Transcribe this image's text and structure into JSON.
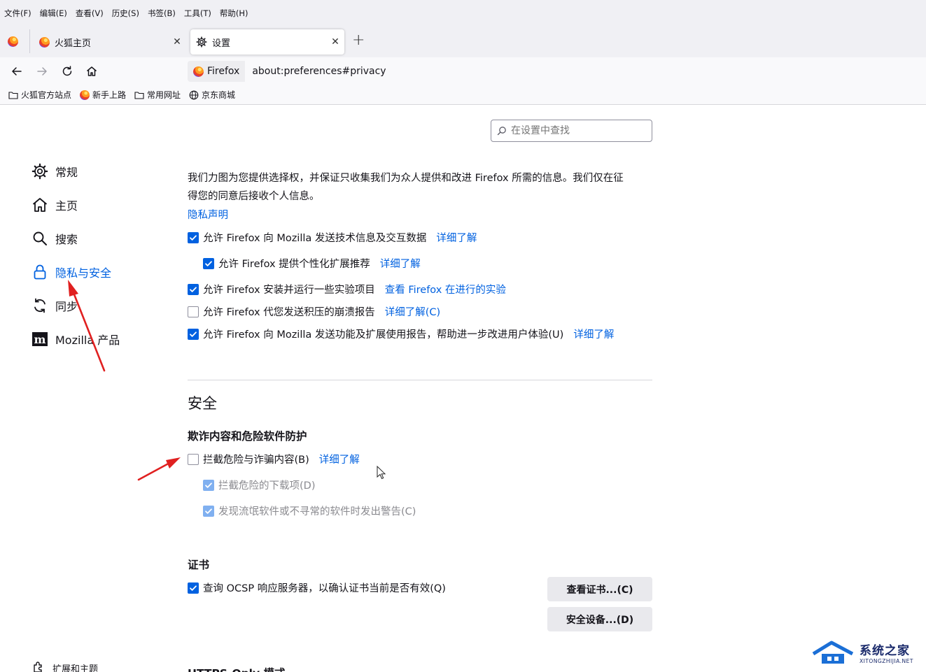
{
  "menu": [
    "文件(F)",
    "编辑(E)",
    "查看(V)",
    "历史(S)",
    "书签(B)",
    "工具(T)",
    "帮助(H)"
  ],
  "tabs": [
    {
      "label": "火狐主页",
      "active": false
    },
    {
      "label": "设置",
      "active": true
    }
  ],
  "urlbar": {
    "identity": "Firefox",
    "url": "about:preferences#privacy"
  },
  "bookmarks": [
    "火狐官方站点",
    "新手上路",
    "常用网址",
    "京东商城"
  ],
  "search": {
    "placeholder": "在设置中查找"
  },
  "categories": [
    {
      "label": "常规",
      "icon": "gear-icon"
    },
    {
      "label": "主页",
      "icon": "home-icon"
    },
    {
      "label": "搜索",
      "icon": "search-icon"
    },
    {
      "label": "隐私与安全",
      "icon": "lock-icon",
      "selected": true
    },
    {
      "label": "同步",
      "icon": "sync-icon"
    },
    {
      "label": "Mozilla 产品",
      "icon": "mozilla-icon"
    },
    {
      "label": "扩展和主题",
      "icon": "puzzle-icon"
    }
  ],
  "data_collection": {
    "intro_line1": "我们力图为您提供选择权，并保证只收集我们为众人提供和改进 Firefox 所需的信息。我们仅在征",
    "intro_line2": "得您的同意后接收个人信息。",
    "privacy_link": "隐私声明",
    "items": [
      {
        "label": "允许 Firefox 向 Mozilla 发送技术信息及交互数据",
        "link": "详细了解",
        "checked": true
      },
      {
        "label": "允许 Firefox 提供个性化扩展推荐",
        "link": "详细了解",
        "checked": true
      },
      {
        "label": "允许 Firefox 安装并运行一些实验项目",
        "link": "查看 Firefox 在进行的实验",
        "checked": true
      },
      {
        "label": "允许 Firefox 代您发送积压的崩溃报告",
        "link": "详细了解(C)",
        "checked": false
      },
      {
        "label": "允许 Firefox 向 Mozilla 发送功能及扩展使用报告，帮助进一步改进用户体验(U)",
        "link": "详细了解",
        "checked": true
      }
    ]
  },
  "security": {
    "title": "安全",
    "phishing_heading": "欺诈内容和危险软件防护",
    "block_dangerous": {
      "label": "拦截危险与诈骗内容(B)",
      "link": "详细了解",
      "checked": false
    },
    "block_downloads": {
      "label": "拦截危险的下载项(D)",
      "checked": true,
      "disabled": true
    },
    "warn_unwanted": {
      "label": "发现流氓软件或不寻常的软件时发出警告(C)",
      "checked": true,
      "disabled": true
    },
    "cert_heading": "证书",
    "ocsp": {
      "label": "查询 OCSP 响应服务器，以确认证书当前是否有效(Q)",
      "checked": true
    },
    "view_certs_button": "查看证书...(C)",
    "security_devices_button": "安全设备...(D)",
    "next_heading_partial": "HTTPS-Only 模式"
  },
  "watermark": {
    "title": "系统之家",
    "subtitle": "XITONGZHIJIA.NET"
  },
  "colors": {
    "accent": "#0061e0",
    "annotation_arrow": "#e02020"
  }
}
